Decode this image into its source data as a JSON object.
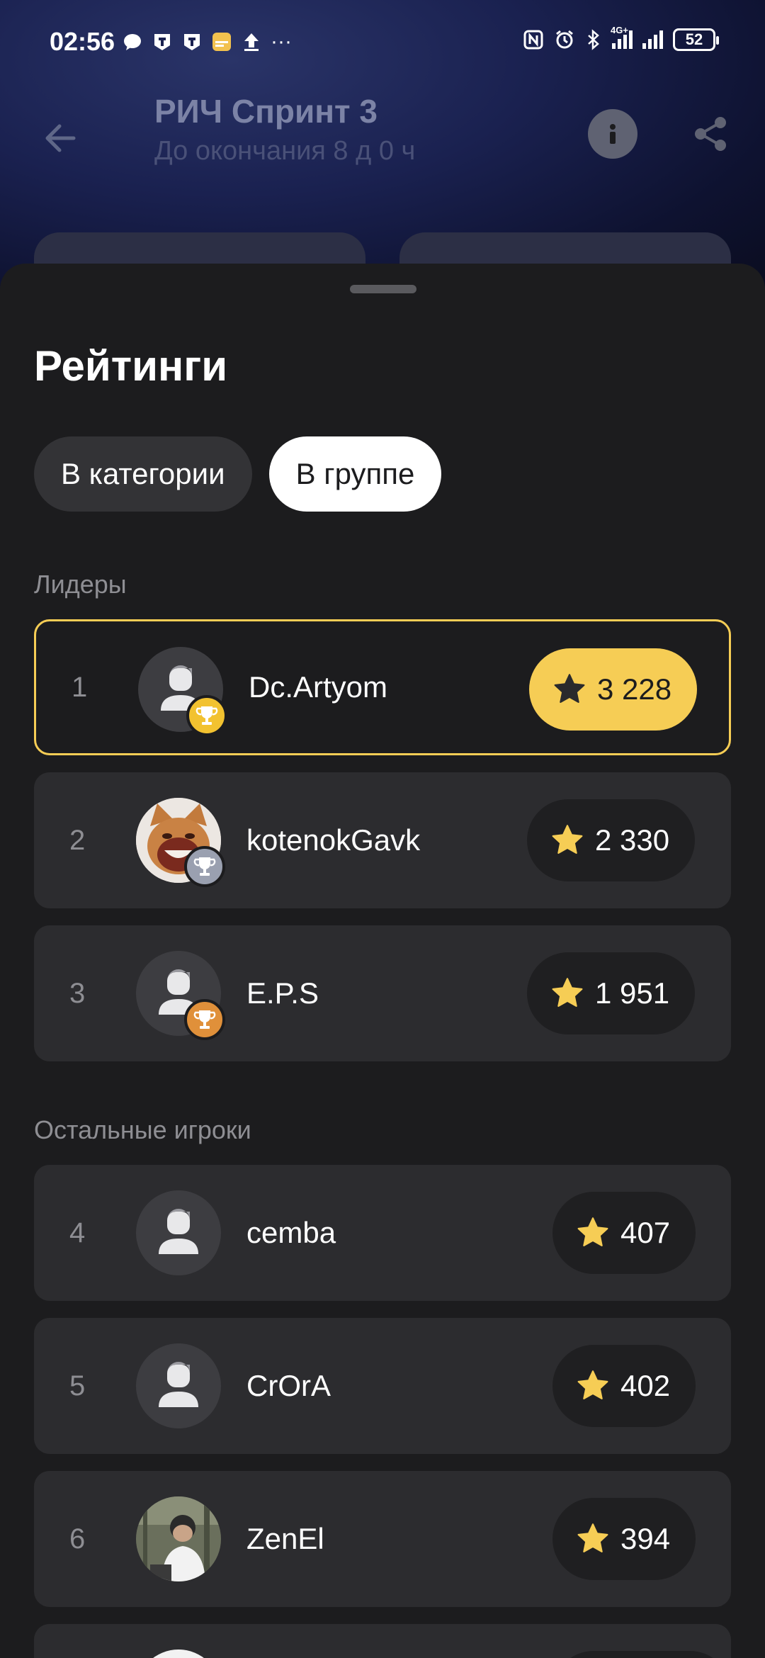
{
  "status_bar": {
    "time": "02:56",
    "more": "···",
    "net_label": "4G+",
    "battery": "52"
  },
  "header": {
    "title": "РИЧ Спринт 3",
    "subtitle": "До окончания 8 д 0 ч"
  },
  "sheet": {
    "title": "Рейтинги",
    "tabs": [
      {
        "label": "В категории",
        "active": false
      },
      {
        "label": "В группе",
        "active": true
      }
    ],
    "leaders_label": "Лидеры",
    "others_label": "Остальные игроки",
    "leaders": [
      {
        "rank": "1",
        "name": "Dc.Artyom",
        "score": "3 228",
        "trophy": "gold",
        "avatar": "default"
      },
      {
        "rank": "2",
        "name": "kotenokGavk",
        "score": "2 330",
        "trophy": "silver",
        "avatar": "cat-photo"
      },
      {
        "rank": "3",
        "name": "E.P.S",
        "score": "1 951",
        "trophy": "bronze",
        "avatar": "default"
      }
    ],
    "others": [
      {
        "rank": "4",
        "name": "cemba",
        "score": "407",
        "avatar": "default"
      },
      {
        "rank": "5",
        "name": "CrOrA",
        "score": "402",
        "avatar": "default"
      },
      {
        "rank": "6",
        "name": "ZenEl",
        "score": "394",
        "avatar": "person-photo"
      }
    ]
  },
  "colors": {
    "accent_gold": "#f6cd55",
    "trophy_gold": "#f2c230",
    "trophy_silver": "#9aa0b0",
    "trophy_bronze": "#e0903a",
    "star": "#f6cd55"
  }
}
